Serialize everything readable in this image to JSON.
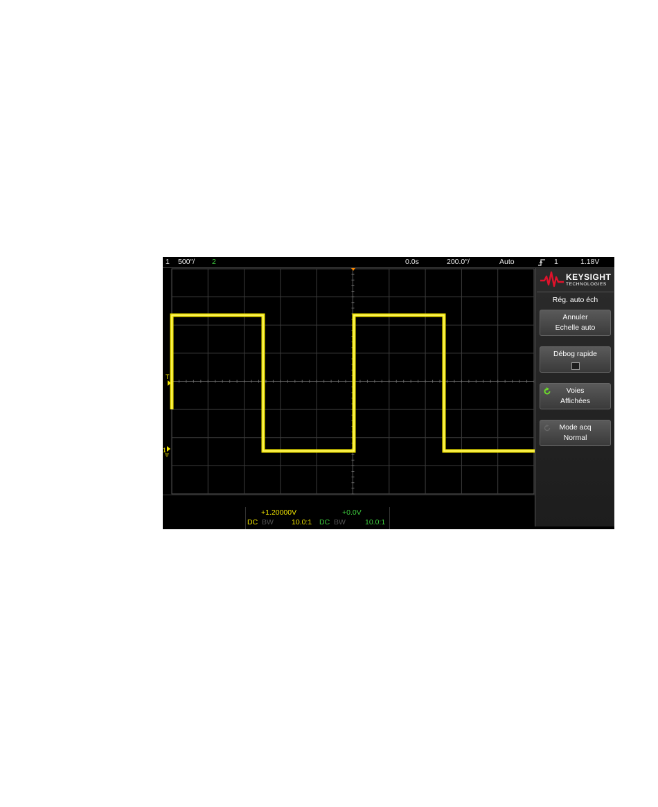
{
  "topbar": {
    "channel1": "1",
    "ch1_scale": "500″/",
    "channel2": "2",
    "time_delay": "0.0s",
    "time_scale": "200.0″/",
    "trigger_mode": "Auto",
    "trigger_edge_icon": "rising-edge-icon",
    "trigger_source": "1",
    "trigger_level": "1.18V"
  },
  "colors": {
    "channel1": "#f2e600",
    "channel2": "#3ecf3e",
    "grid": "#3c3c3c",
    "trigger_marker": "#ff8a00",
    "logo_red": "#e0122b"
  },
  "markers": {
    "trigger": "T",
    "ground": "1"
  },
  "softkeys": {
    "brand": "KEYSIGHT",
    "brand_sub": "TECHNOLOGIES",
    "menu_title": "Rég. auto éch",
    "items": [
      {
        "line1": "Annuler",
        "line2": "Echelle auto",
        "icon": ""
      },
      {
        "line1": "Débog rapide",
        "line2": "",
        "icon": "checkbox-icon"
      },
      {
        "line1": "Voies",
        "line2": "Affichées",
        "icon": "rotate-arrow-icon"
      },
      {
        "line1": "Mode acq",
        "line2": "Normal",
        "icon": "rotate-arrow-icon"
      }
    ]
  },
  "bottom": {
    "ch1": {
      "offset": "+1.20000V",
      "coupling": "DC",
      "bw": "BW",
      "probe": "10.0:1"
    },
    "ch2": {
      "offset": "+0.0V",
      "coupling": "DC",
      "bw": "BW",
      "probe": "10.0:1"
    }
  }
}
